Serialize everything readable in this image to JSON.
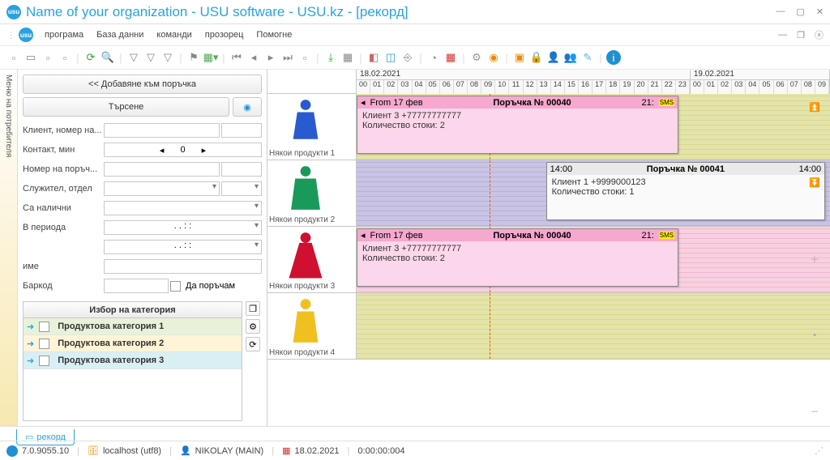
{
  "window": {
    "title": "Name of your organization - USU software - USU.kz - [рекорд]"
  },
  "menu": {
    "items": [
      "програма",
      "База данни",
      "команди",
      "прозорец",
      "Помогне"
    ]
  },
  "sidetab": {
    "label": "Меню на потребителя"
  },
  "left": {
    "add_btn": "<< Добавяне към поръчка",
    "search_btn": "Търсене",
    "rows": {
      "client": "Клиент, номер на...",
      "contact": "Контакт, мин",
      "contact_val": "0",
      "orderno": "Номер на поръч...",
      "employee": "Служител, отдел",
      "instock": "Са налични",
      "period": "В периода",
      "period1": ". .    : :",
      "period2": ". .    : :",
      "name": "име",
      "barcode": "Баркод",
      "toorder": "Да поръчам"
    },
    "cat_header": "Избор на категория",
    "cats": [
      "Продуктова категория 1",
      "Продуктова категория 2",
      "Продуктова категория 3"
    ]
  },
  "timeline": {
    "dates": [
      "18.02.2021",
      "19.02.2021"
    ],
    "hours": [
      "00",
      "01",
      "02",
      "03",
      "04",
      "05",
      "06",
      "07",
      "08",
      "09",
      "10",
      "11",
      "12",
      "13",
      "14",
      "15",
      "16",
      "17",
      "18",
      "19",
      "20",
      "21",
      "22",
      "23"
    ],
    "rows": [
      {
        "label": "Някои продукти 1",
        "dress": "#2a5ad0"
      },
      {
        "label": "Някои продукти 2",
        "dress": "#1a9a5a"
      },
      {
        "label": "Някои продукти 3",
        "dress": "#d01030"
      },
      {
        "label": "Някои продукти 4",
        "dress": "#f0c020"
      }
    ],
    "cards": {
      "c1": {
        "from": "From 17 фев",
        "title": "Поръчка № 00040",
        "end": "21:",
        "tag": "SMS",
        "l1": "Клиент 3 +77777777777",
        "l2": "Количество стоки: 2"
      },
      "c2": {
        "from": "14:00",
        "title": "Поръчка № 00041",
        "end": "14:00",
        "l1": "Клиент 1 +9999000123",
        "l2": "Количество стоки: 1"
      },
      "c3": {
        "from": "From 17 фев",
        "title": "Поръчка № 00040",
        "end": "21:",
        "tag": "SMS",
        "l1": "Клиент 3 +77777777777",
        "l2": "Количество стоки: 2"
      }
    }
  },
  "tab": {
    "label": "рекорд"
  },
  "status": {
    "version": "7.0.9055.10",
    "host": "localhost (utf8)",
    "user": "NIKOLAY (MAIN)",
    "date": "18.02.2021",
    "time": "0:00:00:004"
  }
}
